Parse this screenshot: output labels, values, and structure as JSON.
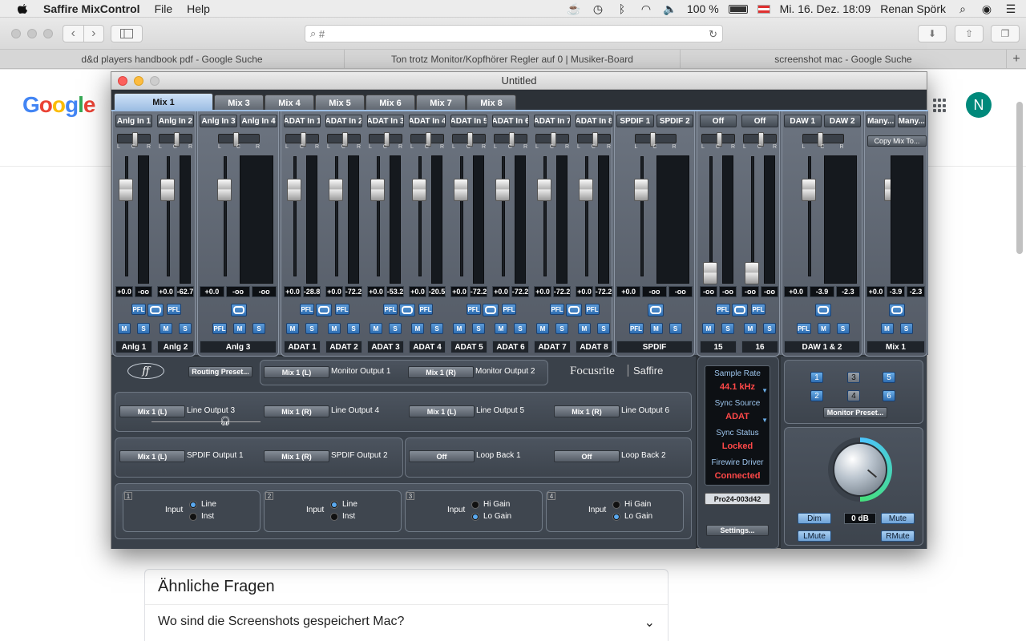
{
  "menubar": {
    "app_name": "Saffire MixControl",
    "menus": [
      "File",
      "Help"
    ],
    "battery": "100 %",
    "datetime": "Mi. 16. Dez.  18:09",
    "user": "Renan Spörk"
  },
  "browser": {
    "url_placeholder": "#",
    "tabs": [
      "d&d players handbook pdf - Google Suche",
      "Ton trotz Monitor/Kopfhörer Regler auf 0 | Musiker-Board",
      "screenshot mac - Google Suche"
    ],
    "new_tab": "+"
  },
  "google": {
    "logo": [
      "G",
      "o",
      "o",
      "g",
      "l",
      "e"
    ],
    "avatar": "N",
    "related_title": "Ähnliche Fragen",
    "related_question": "Wo sind die Screenshots gespeichert Mac?"
  },
  "mixcontrol": {
    "window_title": "Untitled",
    "mix_tabs": [
      "Mix 1",
      "Mix 3",
      "Mix 4",
      "Mix 5",
      "Mix 6",
      "Mix 7",
      "Mix 8"
    ],
    "pan_labels": [
      "L",
      "C",
      "R"
    ],
    "channels": [
      {
        "name": "Anlg In 1",
        "label": "Anlg 1",
        "v1": "+0.0",
        "v2": "-oo"
      },
      {
        "name": "Anlg In 2",
        "label": "Anlg 2",
        "v1": "+0.0",
        "v2": "-62.7"
      },
      {
        "name": "Anlg In 3",
        "label": "Anlg 3",
        "v1": "+0.0",
        "v2": "-oo"
      },
      {
        "name": "Anlg In 4",
        "label": "",
        "v1": "",
        "v2": "-oo"
      },
      {
        "name": "ADAT In 1",
        "label": "ADAT 1",
        "v1": "+0.0",
        "v2": "-28.8"
      },
      {
        "name": "ADAT In 2",
        "label": "ADAT 2",
        "v1": "+0.0",
        "v2": "-72.2"
      },
      {
        "name": "ADAT In 3",
        "label": "ADAT 3",
        "v1": "+0.0",
        "v2": "-53.2"
      },
      {
        "name": "ADAT In 4",
        "label": "ADAT 4",
        "v1": "+0.0",
        "v2": "-20.5"
      },
      {
        "name": "ADAT In 5",
        "label": "ADAT 5",
        "v1": "+0.0",
        "v2": "-72.2"
      },
      {
        "name": "ADAT In 6",
        "label": "ADAT 6",
        "v1": "+0.0",
        "v2": "-72.2"
      },
      {
        "name": "ADAT In 7",
        "label": "ADAT 7",
        "v1": "+0.0",
        "v2": "-72.2"
      },
      {
        "name": "ADAT In 8",
        "label": "ADAT 8",
        "v1": "+0.0",
        "v2": "-72.2"
      },
      {
        "name": "SPDIF 1",
        "label": "SPDIF",
        "v1": "+0.0",
        "v2": "-oo"
      },
      {
        "name": "SPDIF 2",
        "label": "",
        "v1": "",
        "v2": "-oo"
      },
      {
        "name": "Off",
        "label": "15",
        "v1": "-oo",
        "v2": "-oo"
      },
      {
        "name": "Off",
        "label": "16",
        "v1": "-oo",
        "v2": "-oo"
      },
      {
        "name": "DAW 1",
        "label": "DAW 1 & 2",
        "v1": "+0.0",
        "v2": "-3.9"
      },
      {
        "name": "DAW 2",
        "label": "",
        "v1": "",
        "v2": "-2.3"
      },
      {
        "name": "Many...",
        "label": "Mix 1",
        "v1": "+0.0",
        "v2": "-3.9"
      },
      {
        "name": "Many...",
        "label": "",
        "v1": "",
        "v2": "-2.3"
      }
    ],
    "buttons": {
      "pfl": "PFL",
      "mute": "M",
      "solo": "S",
      "copy_mix": "Copy Mix To..."
    },
    "routing": {
      "preset": "Routing Preset...",
      "brand": "Focusrite",
      "product": "Saffire",
      "monitor": [
        {
          "src": "Mix 1 (L)",
          "dst": "Monitor Output 1"
        },
        {
          "src": "Mix 1 (R)",
          "dst": "Monitor Output 2"
        }
      ],
      "lines": [
        {
          "src": "Mix 1 (L)",
          "dst": "Line Output 3"
        },
        {
          "src": "Mix 1 (R)",
          "dst": "Line Output 4"
        },
        {
          "src": "Mix 1 (L)",
          "dst": "Line Output 5"
        },
        {
          "src": "Mix 1 (R)",
          "dst": "Line Output 6"
        }
      ],
      "spdif": [
        {
          "src": "Mix 1 (L)",
          "dst": "SPDIF Output 1"
        },
        {
          "src": "Mix 1 (R)",
          "dst": "SPDIF Output 2"
        }
      ],
      "loop": [
        {
          "src": "Off",
          "dst": "Loop Back 1"
        },
        {
          "src": "Off",
          "dst": "Loop Back 2"
        }
      ]
    },
    "inputs": [
      {
        "num": "1",
        "label": "Input",
        "opt1": "Line",
        "opt2": "Inst",
        "selected": 1
      },
      {
        "num": "2",
        "label": "Input",
        "opt1": "Line",
        "opt2": "Inst",
        "selected": 1
      },
      {
        "num": "3",
        "label": "Input",
        "opt1": "Hi Gain",
        "opt2": "Lo Gain",
        "selected": 2
      },
      {
        "num": "4",
        "label": "Input",
        "opt1": "Hi Gain",
        "opt2": "Lo Gain",
        "selected": 2
      }
    ],
    "status": {
      "sample_rate_label": "Sample Rate",
      "sample_rate": "44.1 kHz",
      "sync_source_label": "Sync Source",
      "sync_source": "ADAT",
      "sync_status_label": "Sync Status",
      "sync_status": "Locked",
      "firewire_label": "Firewire Driver",
      "firewire": "Connected",
      "device": "Pro24-003d42",
      "settings": "Settings..."
    },
    "monitor": {
      "presets": [
        "1",
        "2",
        "3",
        "4",
        "5",
        "6"
      ],
      "preset_button": "Monitor Preset...",
      "dim": "Dim",
      "db": "0 dB",
      "mute": "Mute",
      "lmute": "LMute",
      "rmute": "RMute"
    }
  }
}
